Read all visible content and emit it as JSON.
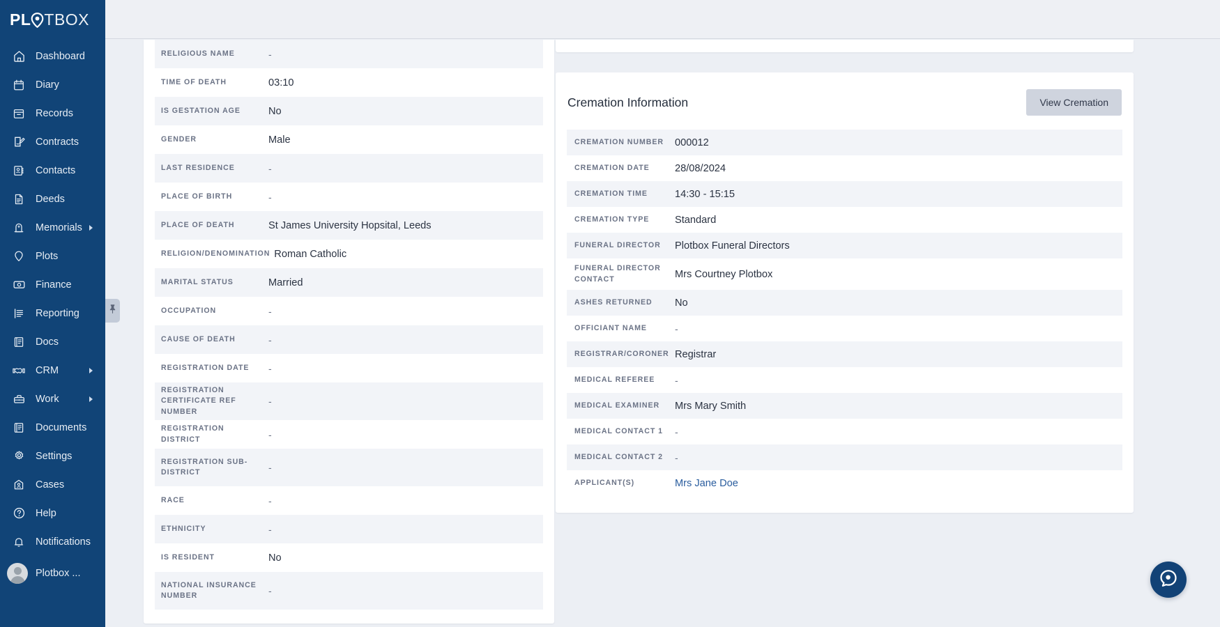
{
  "sidebar": {
    "logo": {
      "bold": "PL",
      "pin_icon": "location-pin-icon",
      "thin": "TBOX",
      "full": "PLOTBOX"
    },
    "items": [
      {
        "label": "Dashboard",
        "icon": "home-icon",
        "has_caret": false
      },
      {
        "label": "Diary",
        "icon": "calendar-icon",
        "has_caret": false
      },
      {
        "label": "Records",
        "icon": "archive-box-icon",
        "has_caret": false
      },
      {
        "label": "Contracts",
        "icon": "contract-pen-icon",
        "has_caret": false
      },
      {
        "label": "Contacts",
        "icon": "address-book-icon",
        "has_caret": false
      },
      {
        "label": "Deeds",
        "icon": "document-icon",
        "has_caret": false
      },
      {
        "label": "Memorials",
        "icon": "headstone-icon",
        "has_caret": true
      },
      {
        "label": "Plots",
        "icon": "map-pin-icon",
        "has_caret": false
      },
      {
        "label": "Finance",
        "icon": "banknote-icon",
        "has_caret": false
      },
      {
        "label": "Reporting",
        "icon": "report-lines-icon",
        "has_caret": false
      },
      {
        "label": "Docs",
        "icon": "book-icon",
        "has_caret": false
      },
      {
        "label": "CRM",
        "icon": "handshake-icon",
        "has_caret": true
      },
      {
        "label": "Work",
        "icon": "toolbox-icon",
        "has_caret": true
      },
      {
        "label": "Documents",
        "icon": "book-icon",
        "has_caret": false
      },
      {
        "label": "Settings",
        "icon": "gear-icon",
        "has_caret": false
      },
      {
        "label": "Cases",
        "icon": "case-house-icon",
        "has_caret": false
      },
      {
        "label": "Help",
        "icon": "question-circle-icon",
        "has_caret": false
      },
      {
        "label": "Notifications",
        "icon": "bell-icon",
        "has_caret": false
      }
    ],
    "user": {
      "label": "Plotbox ...",
      "avatar_icon": "user-avatar-icon"
    },
    "pin_handle": {
      "icon": "pin-icon"
    },
    "colors": {
      "background": "#114477",
      "text": "#e7edf4"
    }
  },
  "deceased_details": {
    "rows": [
      {
        "key": "RELIGIOUS NAME",
        "value": "-",
        "tall": false
      },
      {
        "key": "TIME OF DEATH",
        "value": "03:10",
        "tall": false
      },
      {
        "key": "IS GESTATION AGE",
        "value": "No",
        "tall": false
      },
      {
        "key": "GENDER",
        "value": "Male",
        "tall": false
      },
      {
        "key": "LAST RESIDENCE",
        "value": "-",
        "tall": false
      },
      {
        "key": "PLACE OF BIRTH",
        "value": "-",
        "tall": false
      },
      {
        "key": "PLACE OF DEATH",
        "value": "St James University Hopsital, Leeds",
        "tall": false
      },
      {
        "key": "RELIGION/DENOMINATION",
        "value": "Roman Catholic",
        "tall": false
      },
      {
        "key": "MARITAL STATUS",
        "value": "Married",
        "tall": false
      },
      {
        "key": "OCCUPATION",
        "value": "-",
        "tall": false
      },
      {
        "key": "CAUSE OF DEATH",
        "value": "-",
        "tall": false
      },
      {
        "key": "REGISTRATION DATE",
        "value": "-",
        "tall": false
      },
      {
        "key": "REGISTRATION CERTIFICATE REF NUMBER",
        "value": "-",
        "tall": true
      },
      {
        "key": "REGISTRATION DISTRICT",
        "value": "-",
        "tall": false
      },
      {
        "key": "REGISTRATION SUB-DISTRICT",
        "value": "-",
        "tall": true
      },
      {
        "key": "RACE",
        "value": "-",
        "tall": false
      },
      {
        "key": "ETHNICITY",
        "value": "-",
        "tall": false
      },
      {
        "key": "IS RESIDENT",
        "value": "No",
        "tall": false
      },
      {
        "key": "NATIONAL INSURANCE NUMBER",
        "value": "-",
        "tall": true
      }
    ]
  },
  "cremation_information": {
    "title": "Cremation Information",
    "view_button_label": "View Cremation",
    "rows": [
      {
        "key": "CREMATION NUMBER",
        "value": "000012",
        "tall": false,
        "link": false
      },
      {
        "key": "CREMATION DATE",
        "value": "28/08/2024",
        "tall": false,
        "link": false
      },
      {
        "key": "CREMATION TIME",
        "value": "14:30 - 15:15",
        "tall": false,
        "link": false
      },
      {
        "key": "CREMATION TYPE",
        "value": "Standard",
        "tall": false,
        "link": false
      },
      {
        "key": "FUNERAL DIRECTOR",
        "value": "Plotbox Funeral Directors",
        "tall": false,
        "link": false
      },
      {
        "key": "FUNERAL DIRECTOR CONTACT",
        "value": "Mrs Courtney Plotbox",
        "tall": true,
        "link": false
      },
      {
        "key": "ASHES RETURNED",
        "value": "No",
        "tall": false,
        "link": false
      },
      {
        "key": "OFFICIANT NAME",
        "value": "-",
        "tall": false,
        "link": false
      },
      {
        "key": "REGISTRAR/CORONER",
        "value": "Registrar",
        "tall": false,
        "link": false
      },
      {
        "key": "MEDICAL REFEREE",
        "value": "-",
        "tall": false,
        "link": false
      },
      {
        "key": "MEDICAL EXAMINER",
        "value": "Mrs Mary Smith",
        "tall": false,
        "link": false
      },
      {
        "key": "MEDICAL CONTACT 1",
        "value": "-",
        "tall": false,
        "link": false
      },
      {
        "key": "MEDICAL CONTACT 2",
        "value": "-",
        "tall": false,
        "link": false
      },
      {
        "key": "APPLICANT(S)",
        "value": "Mrs Jane Doe",
        "tall": false,
        "link": true
      }
    ]
  },
  "help_fab": {
    "icon": "chat-bubble-target-icon",
    "color": "#124276"
  }
}
